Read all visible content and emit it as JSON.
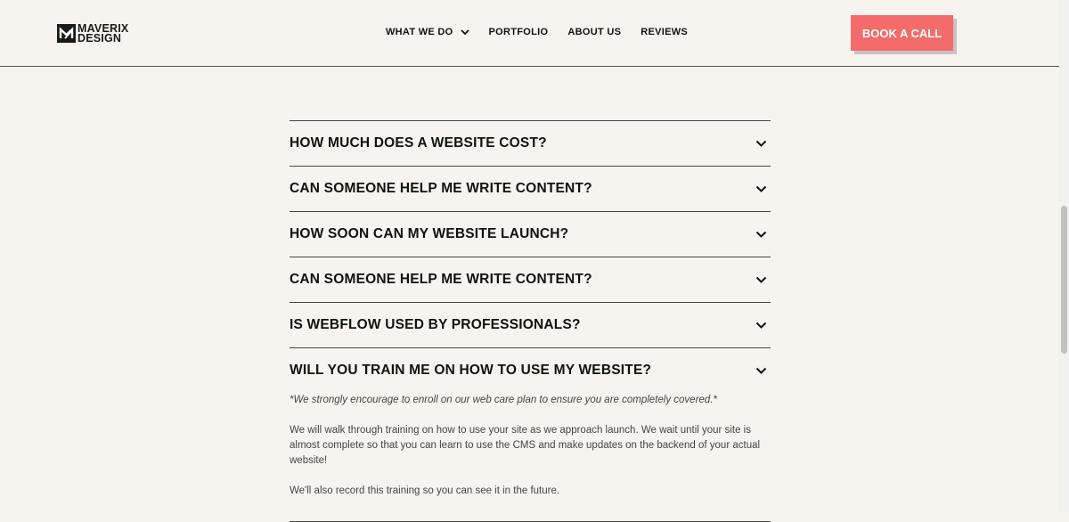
{
  "brand": {
    "line1": "MAVERIX",
    "line2": "DESIGN"
  },
  "nav": {
    "items": [
      {
        "label": "WHAT WE DO",
        "has_dropdown": true
      },
      {
        "label": "PORTFOLIO"
      },
      {
        "label": "ABOUT US"
      },
      {
        "label": "REVIEWS"
      }
    ],
    "cta_label": "BOOK A CALL"
  },
  "faq": {
    "items": [
      {
        "question": "HOW MUCH DOES A WEBSITE COST?",
        "expanded": false
      },
      {
        "question": "CAN SOMEONE HELP ME WRITE CONTENT?",
        "expanded": false
      },
      {
        "question": "HOW SOON CAN MY WEBSITE LAUNCH?",
        "expanded": false
      },
      {
        "question": "CAN SOMEONE HELP ME WRITE CONTENT?",
        "expanded": false
      },
      {
        "question": "IS WEBFLOW USED BY PROFESSIONALS?",
        "expanded": false
      },
      {
        "question": "WILL YOU TRAIN ME ON HOW TO USE MY WEBSITE?",
        "expanded": true,
        "note": "*We strongly encourage to enroll on our web care plan to ensure you are completely covered.*",
        "paragraph1": "We will walk through training on how to use your site as we approach launch. We wait until your site is almost complete so that you can learn to use the CMS and make updates on the backend of your actual website!",
        "paragraph2": "We'll also record this training so you can see it in the future."
      }
    ]
  },
  "colors": {
    "background": "#f7f4ef",
    "accent": "#f36b6b",
    "text": "#111111"
  },
  "icons": {
    "logo": "maverix-logo-icon",
    "dropdown": "chevron-down-icon"
  }
}
